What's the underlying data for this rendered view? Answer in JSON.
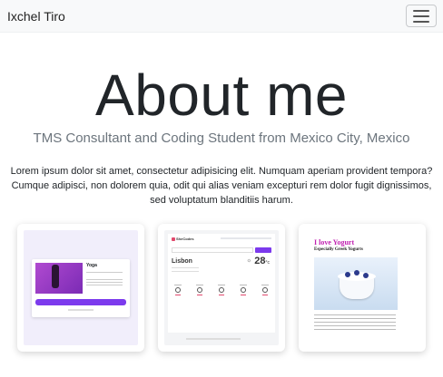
{
  "navbar": {
    "brand": "Ixchel Tiro",
    "toggle_icon": "hamburger-menu-icon"
  },
  "hero": {
    "title": "About me",
    "subtitle": "TMS Consultant and Coding Student from Mexico City, Mexico",
    "text": "Lorem ipsum dolor sit amet, consectetur adipisicing elit. Numquam aperiam provident tempora? Cumque adipisci, non dolorem quia, odit qui alias veniam excepturi rem dolor fugit dignissimos, sed voluptatum blanditiis harum."
  },
  "projects": [
    {
      "title": "Yoga",
      "button": "Be in a yoga class"
    },
    {
      "logo": "SheCodes",
      "city": "Lisbon",
      "temp": "28",
      "unit": "°c",
      "weather_icon": "sun-icon"
    },
    {
      "title": "I love Yogurt",
      "subtitle": "Especially Greek Yogurts"
    }
  ],
  "colors": {
    "navbar_bg": "#f8f9fa",
    "accent_purple": "#7c3aed",
    "yogurt_title": "#c020b0",
    "subtitle_gray": "#6c757d"
  }
}
